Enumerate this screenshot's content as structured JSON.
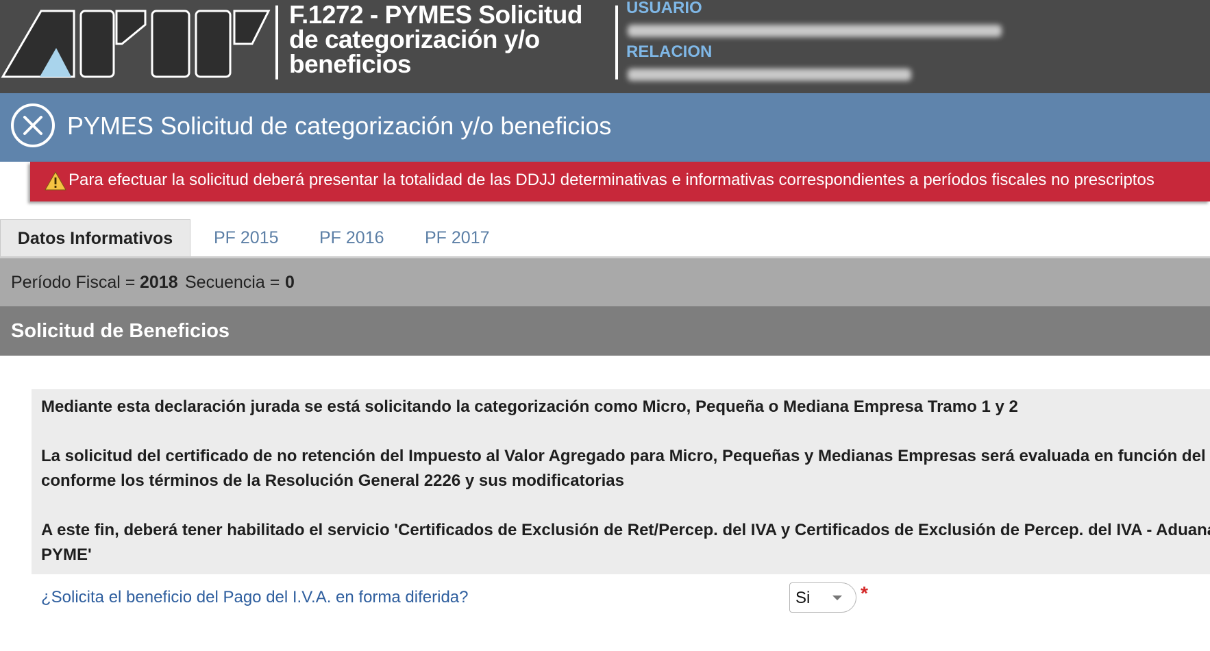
{
  "header": {
    "form_title": "F.1272 - PYMES Solicitud de categorización y/o beneficios",
    "usuario_label": "USUARIO",
    "relacion_label": "RELACION"
  },
  "titlebar": {
    "title": "PYMES Solicitud de categorización y/o beneficios",
    "close_icon": "close-circle-icon"
  },
  "alert": {
    "icon": "warning-triangle-icon",
    "text": "Para efectuar la solicitud deberá presentar la totalidad de las DDJJ determinativas e informativas correspondientes a períodos fiscales no prescriptos"
  },
  "tabs": [
    {
      "label": "Datos Informativos",
      "active": true
    },
    {
      "label": "PF 2015",
      "active": false
    },
    {
      "label": "PF 2016",
      "active": false
    },
    {
      "label": "PF 2017",
      "active": false
    }
  ],
  "periodo": {
    "label": "Período Fiscal =",
    "value": "2018",
    "secuencia_label": "Secuencia =",
    "secuencia_value": "0"
  },
  "section": {
    "title": "Solicitud de Beneficios"
  },
  "info": {
    "line1": "Mediante esta declaración jurada se está solicitando la categorización como Micro, Pequeña o Mediana Empresa Tramo 1 y 2",
    "line2": "La solicitud del certificado de no retención del Impuesto al Valor Agregado para Micro, Pequeñas y Medianas Empresas será evaluada en función del",
    "line3": "conforme los términos de la Resolución General 2226 y sus modificatorias",
    "line4": "A este fin, deberá tener habilitado el servicio 'Certificados de Exclusión de Ret/Percep. del IVA y Certificados de Exclusión de Percep. del IVA - Aduana",
    "line5": "PYME'"
  },
  "question": {
    "text": "¿Solicita el beneficio del Pago del I.V.A. en forma diferida?",
    "selected": "Si",
    "required_mark": "*"
  },
  "colors": {
    "header_bg": "#4a4a4a",
    "titlebar_bg": "#5f84ac",
    "alert_bg": "#c7283a",
    "section_bg": "#7e7e7e",
    "link_blue": "#2e5e9e"
  }
}
